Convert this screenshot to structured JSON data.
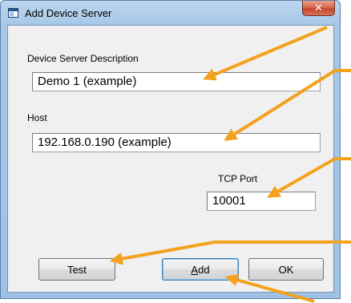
{
  "window": {
    "title": "Add Device Server",
    "close_glyph": "✕",
    "icon": "app-window-icon"
  },
  "form": {
    "description_label": "Device Server Description",
    "description_value": "Demo 1 (example)",
    "host_label": "Host",
    "host_value": "192.168.0.190 (example)",
    "port_label": "TCP Port",
    "port_value": "10001"
  },
  "buttons": {
    "test": "Test",
    "add_accel": "A",
    "add_rest": "dd",
    "ok": "OK"
  },
  "colors": {
    "annotation_arrow": "#f4a21e",
    "titlebar": "#a7c8e8",
    "close_button": "#c2462c"
  }
}
